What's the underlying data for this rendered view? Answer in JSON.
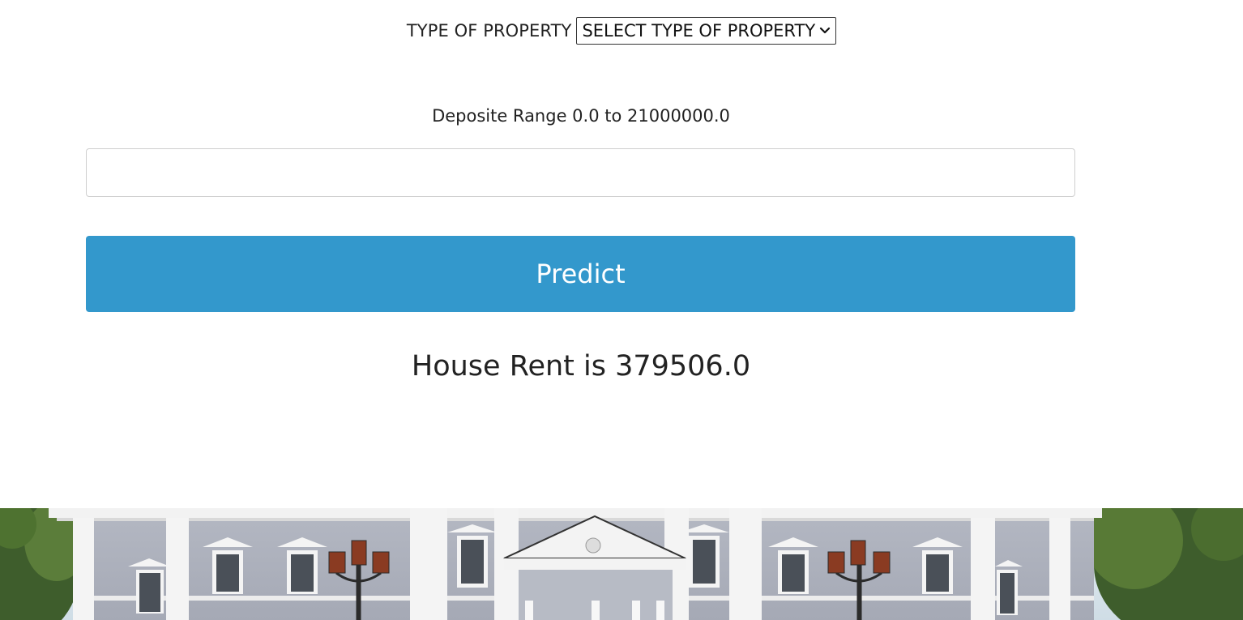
{
  "form": {
    "type_label": "TYPE OF PROPERTY",
    "type_select_value": "SELECT TYPE OF PROPERTY",
    "deposit_label": "Deposite Range 0.0 to 21000000.0",
    "deposit_value": "",
    "predict_label": "Predict"
  },
  "result": {
    "text": "House Rent is 379506.0"
  },
  "colors": {
    "button_bg": "#3398cc",
    "button_text": "#ffffff",
    "text": "#222222"
  },
  "icons": {
    "select_caret": "chevron-down-icon"
  }
}
